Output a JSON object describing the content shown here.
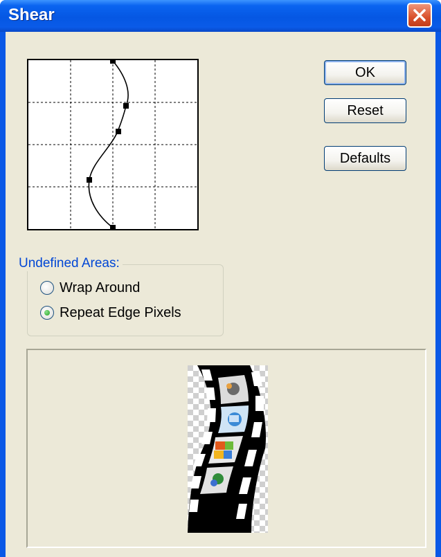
{
  "window": {
    "title": "Shear",
    "close_icon": "close-x-icon"
  },
  "curve_editor": {
    "control_points_count_visible": 5
  },
  "buttons": {
    "ok": "OK",
    "reset": "Reset",
    "defaults": "Defaults"
  },
  "undefined_areas": {
    "label": "Undefined Areas:",
    "options": [
      {
        "label": "Wrap Around",
        "selected": false
      },
      {
        "label": "Repeat Edge Pixels",
        "selected": true
      }
    ]
  },
  "preview": {
    "image_icon": "sheared-filmstrip-preview"
  },
  "colors": {
    "title_bar": "#0a58e6",
    "dialog_bg": "#ece9d8",
    "group_label": "#0046d5",
    "close_button": "#d9512c"
  }
}
